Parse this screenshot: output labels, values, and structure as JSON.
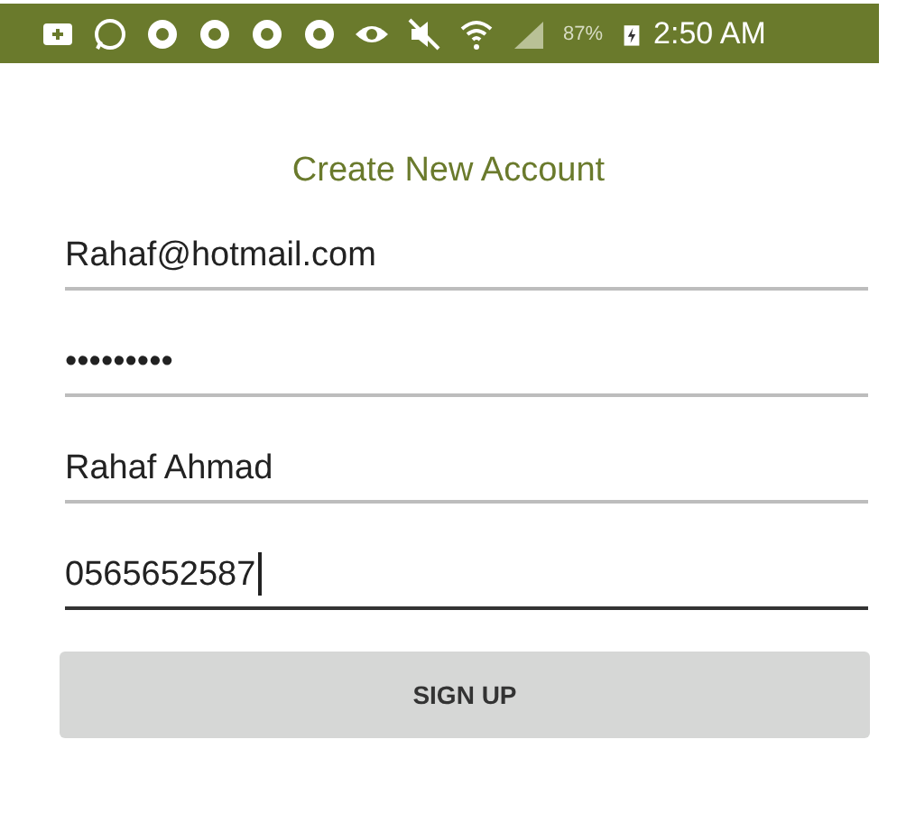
{
  "status_bar": {
    "battery": "87%",
    "time": "2:50 AM"
  },
  "title": "Create New Account",
  "fields": [
    {
      "value": "Rahaf@hotmail.com",
      "focused": false
    },
    {
      "value": "•••••••••",
      "focused": false
    },
    {
      "value": "Rahaf Ahmad",
      "focused": false
    },
    {
      "value": "0565652587",
      "focused": true
    }
  ],
  "button": "SIGN UP"
}
